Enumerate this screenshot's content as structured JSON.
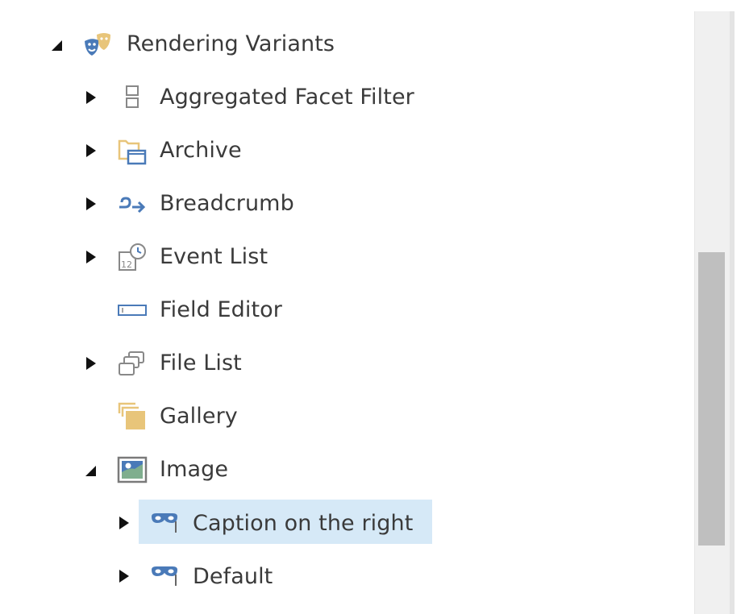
{
  "tree": {
    "root": {
      "label": "Rendering Variants",
      "icon": "theater-masks-icon",
      "expanded": true
    },
    "items": [
      {
        "label": "Aggregated Facet Filter",
        "icon": "facet-filter-icon",
        "expandable": true,
        "expanded": false
      },
      {
        "label": "Archive",
        "icon": "archive-folder-icon",
        "expandable": true,
        "expanded": false
      },
      {
        "label": "Breadcrumb",
        "icon": "breadcrumb-arrow-icon",
        "expandable": true,
        "expanded": false
      },
      {
        "label": "Event List",
        "icon": "calendar-clock-icon",
        "expandable": true,
        "expanded": false
      },
      {
        "label": "Field Editor",
        "icon": "field-input-icon",
        "expandable": false
      },
      {
        "label": "File List",
        "icon": "file-list-windows-icon",
        "expandable": true,
        "expanded": false
      },
      {
        "label": "Gallery",
        "icon": "gallery-folder-icon",
        "expandable": false
      },
      {
        "label": "Image",
        "icon": "picture-icon",
        "expandable": true,
        "expanded": true,
        "children": [
          {
            "label": "Caption on the right",
            "icon": "mask-variant-icon",
            "expandable": true,
            "expanded": false,
            "selected": true
          },
          {
            "label": "Default",
            "icon": "mask-variant-icon",
            "expandable": true,
            "expanded": false
          }
        ]
      }
    ]
  },
  "colors": {
    "selection": "#d6e9f7",
    "text": "#3a3a3a",
    "icon_blue": "#4a7ab8",
    "icon_gold": "#e8c57a"
  },
  "scrollbar": {
    "position_fraction": 0.5,
    "visible_fraction": 0.49
  }
}
